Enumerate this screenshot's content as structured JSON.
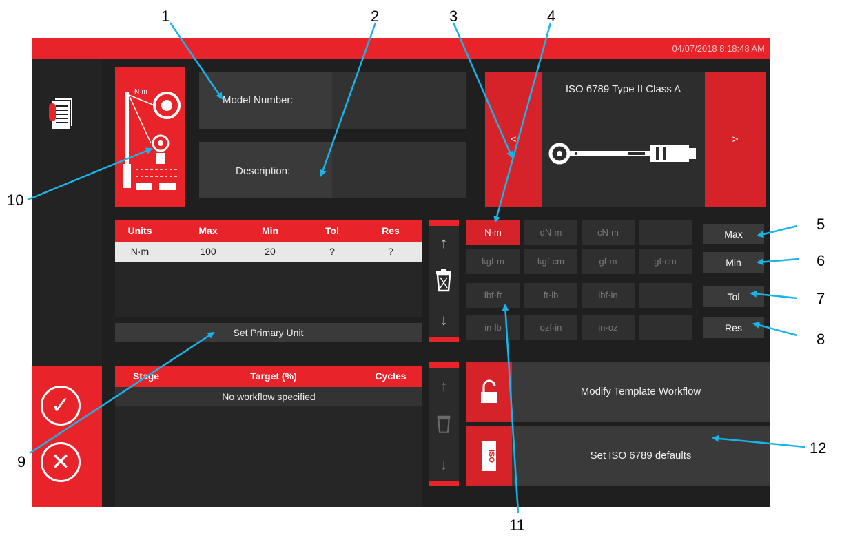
{
  "callouts": [
    "1",
    "2",
    "3",
    "4",
    "5",
    "6",
    "7",
    "8",
    "9",
    "10",
    "11",
    "12"
  ],
  "header": {
    "datetime": "04/07/2018 8:18:48 AM"
  },
  "fields": {
    "model_label": "Model Number:",
    "description_label": "Description:"
  },
  "template": {
    "title": "ISO 6789 Type II Class A",
    "prev_label": "<",
    "next_label": ">"
  },
  "units_table": {
    "headers": [
      "Units",
      "Max",
      "Min",
      "Tol",
      "Res"
    ],
    "row": [
      "N·m",
      "100",
      "20",
      "?",
      "?"
    ]
  },
  "set_primary_label": "Set Primary Unit",
  "unit_grid": [
    [
      "N·m",
      "dN·m",
      "cN·m",
      ""
    ],
    [
      "kgf·m",
      "kgf·cm",
      "gf·m",
      "gf·cm"
    ],
    [
      "lbf·ft",
      "ft·lb",
      "lbf·in",
      ""
    ],
    [
      "in·lb",
      "ozf·in",
      "in·oz",
      ""
    ]
  ],
  "side_buttons": [
    "Max",
    "Min",
    "Tol",
    "Res"
  ],
  "workflow_table": {
    "headers": [
      "Stage",
      "Target (%)",
      "Cycles"
    ],
    "empty_text": "No workflow specified"
  },
  "actions": {
    "modify_workflow": "Modify Template Workflow",
    "set_iso_defaults": "Set ISO 6789 defaults",
    "iso_icon_text": "ISO"
  },
  "colors": {
    "accent": "#e8232a",
    "background": "#1f1f1f",
    "callout_line": "#19b5ea"
  },
  "icons": [
    "document-icon",
    "checkmark-icon",
    "close-icon",
    "lock-icon",
    "iso-icon",
    "trash-icon",
    "arrow-up-icon",
    "arrow-down-icon",
    "torque-wrench-icon",
    "tool-diagram-icon"
  ]
}
